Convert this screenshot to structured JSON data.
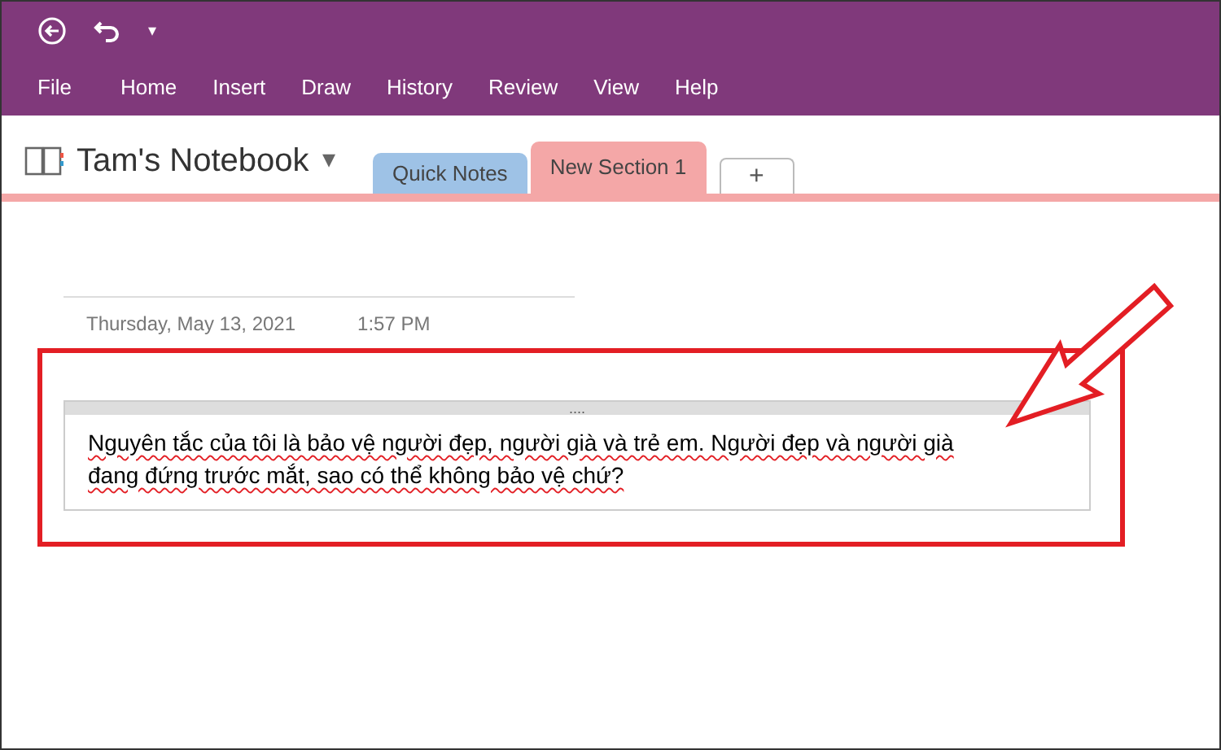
{
  "quick_access": {
    "overflow": "▾"
  },
  "menu": [
    "File",
    "Home",
    "Insert",
    "Draw",
    "History",
    "Review",
    "View",
    "Help"
  ],
  "notebook": {
    "title": "Tam's Notebook",
    "dropdown": "▾"
  },
  "section_tabs": [
    {
      "label": "Quick Notes",
      "color": "#9ec2e6",
      "selected": false
    },
    {
      "label": "New Section 1",
      "color": "#f4a7a7",
      "selected": true
    },
    {
      "label": "+",
      "kind": "add"
    }
  ],
  "page": {
    "date": "Thursday, May 13, 2021",
    "time": "1:57 PM",
    "note": {
      "handle": "....",
      "misspelled": true,
      "lines": [
        "Nguyên tắc của tôi là bảo vệ người đẹp, người già và trẻ em. Người đẹp và người già",
        "đang đứng trước mắt, sao có thể không bảo vệ chứ?"
      ]
    }
  },
  "annotation": {
    "highlight": true,
    "arrow": true
  }
}
